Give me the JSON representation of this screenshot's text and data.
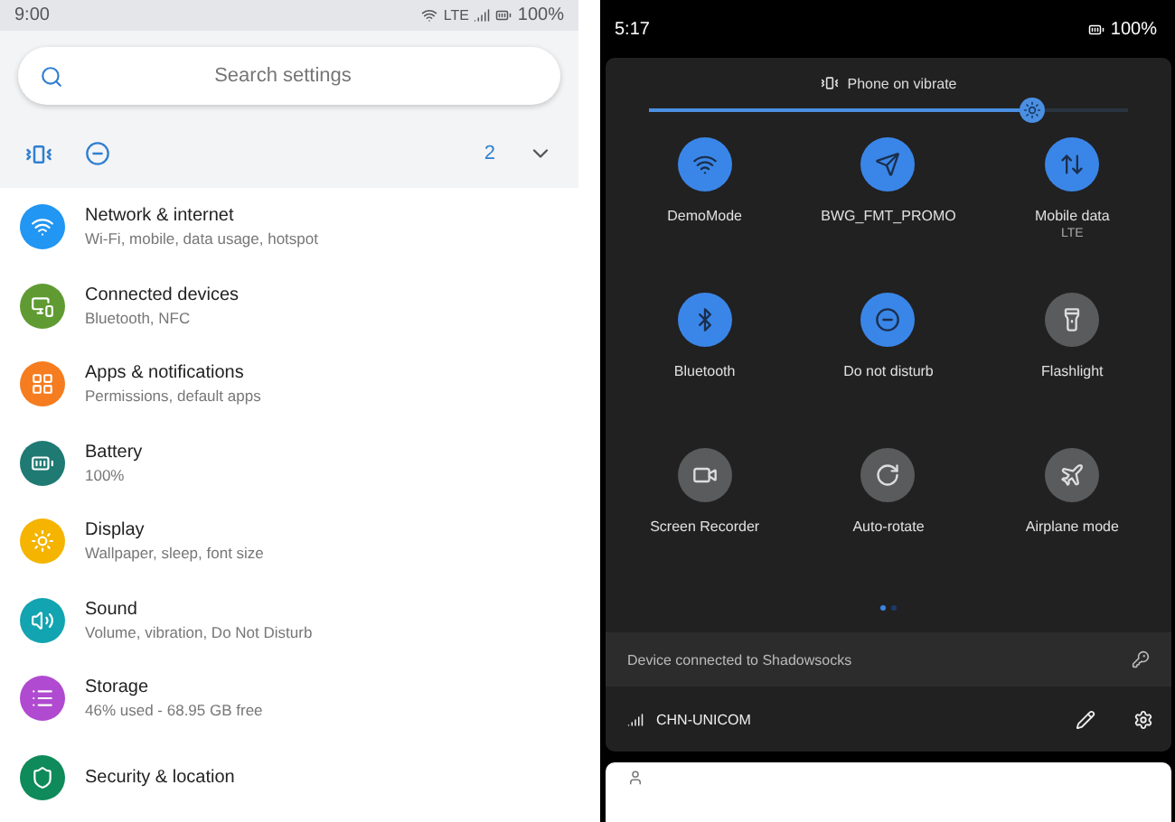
{
  "settings_screen": {
    "status_bar": {
      "time": "9:00",
      "network": "LTE",
      "battery": "100%"
    },
    "search": {
      "placeholder": "Search settings"
    },
    "conditions": {
      "count": "2",
      "expanded": false
    },
    "items": [
      {
        "title": "Network & internet",
        "subtitle": "Wi-Fi, mobile, data usage, hotspot",
        "color": "#2196f3"
      },
      {
        "title": "Connected devices",
        "subtitle": "Bluetooth, NFC",
        "color": "#5f9b32"
      },
      {
        "title": "Apps & notifications",
        "subtitle": "Permissions, default apps",
        "color": "#f57c1f"
      },
      {
        "title": "Battery",
        "subtitle": "100%",
        "color": "#1f7a73"
      },
      {
        "title": "Display",
        "subtitle": "Wallpaper, sleep, font size",
        "color": "#f4b400"
      },
      {
        "title": "Sound",
        "subtitle": "Volume, vibration, Do Not Disturb",
        "color": "#12a4b0"
      },
      {
        "title": "Storage",
        "subtitle": "46% used - 68.95 GB free",
        "color": "#b04ad0"
      },
      {
        "title": "Security & location",
        "color": "#0f8a5a"
      }
    ]
  },
  "quick_settings": {
    "status_bar": {
      "time": "5:17",
      "battery": "100%"
    },
    "ringer": "Phone on vibrate",
    "brightness": {
      "level": 0.8
    },
    "tiles": [
      {
        "label": "DemoMode",
        "on": true
      },
      {
        "label": "BWG_FMT_PROMO",
        "on": true
      },
      {
        "label": "Mobile data",
        "sublabel": "LTE",
        "on": true
      },
      {
        "label": "Bluetooth",
        "on": true
      },
      {
        "label": "Do not disturb",
        "on": true
      },
      {
        "label": "Flashlight",
        "on": false
      },
      {
        "label": "Screen Recorder",
        "on": false
      },
      {
        "label": "Auto-rotate",
        "on": false
      },
      {
        "label": "Airplane mode",
        "on": false
      }
    ],
    "pages": [
      {
        "selected": true
      },
      {
        "selected": false
      }
    ],
    "vpn_notice": "Device connected to Shadowsocks",
    "carrier": "CHN-UNICOM"
  }
}
